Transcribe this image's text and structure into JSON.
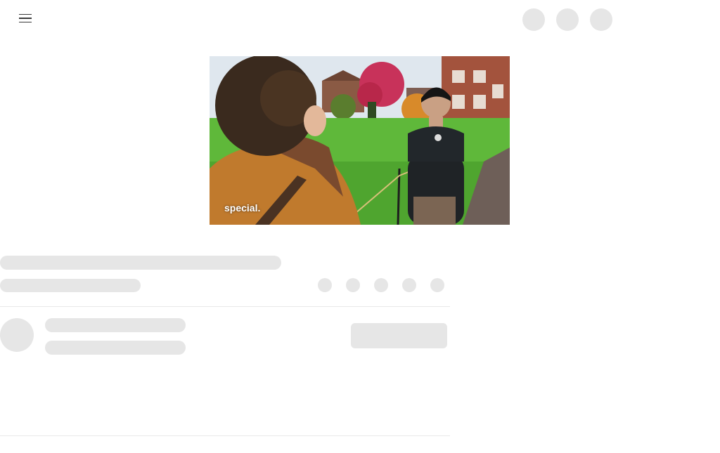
{
  "header": {
    "menu_icon": "hamburger-menu-icon",
    "action_placeholders": [
      "placeholder-circle",
      "placeholder-circle",
      "placeholder-circle"
    ]
  },
  "video": {
    "caption": "special."
  },
  "colors": {
    "skeleton": "#e6e6e6",
    "divider": "#e8e8e8",
    "background": "#ffffff"
  }
}
